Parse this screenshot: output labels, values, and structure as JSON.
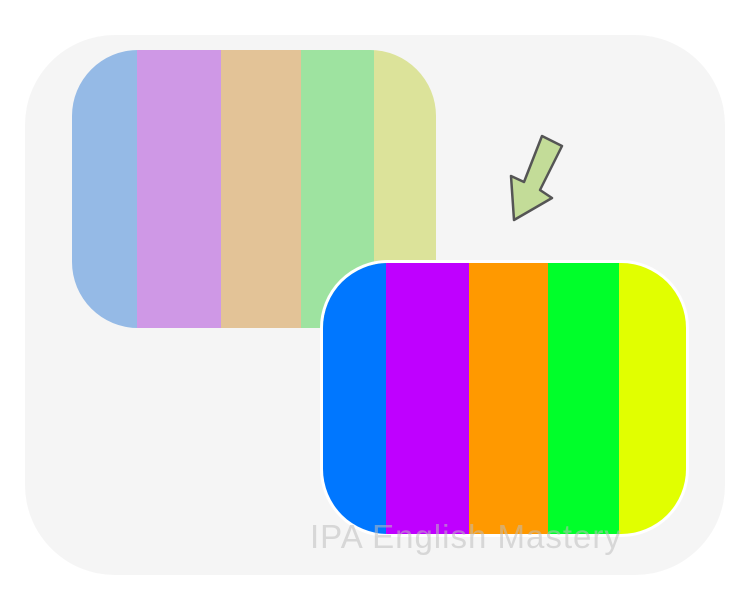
{
  "colors": {
    "background": "#f5f5f5",
    "faded_stripes": [
      "#95bae6",
      "#cf98e6",
      "#e3c397",
      "#9ee3a0",
      "#dce39a"
    ],
    "vivid_stripes": [
      "#0077ff",
      "#bf00ff",
      "#ff9900",
      "#00ff2a",
      "#e1ff00"
    ],
    "arrow": "#c3dc98"
  },
  "icons": {
    "arrow": "arrow-down-left-icon"
  },
  "watermark": "IPA English Mastery"
}
